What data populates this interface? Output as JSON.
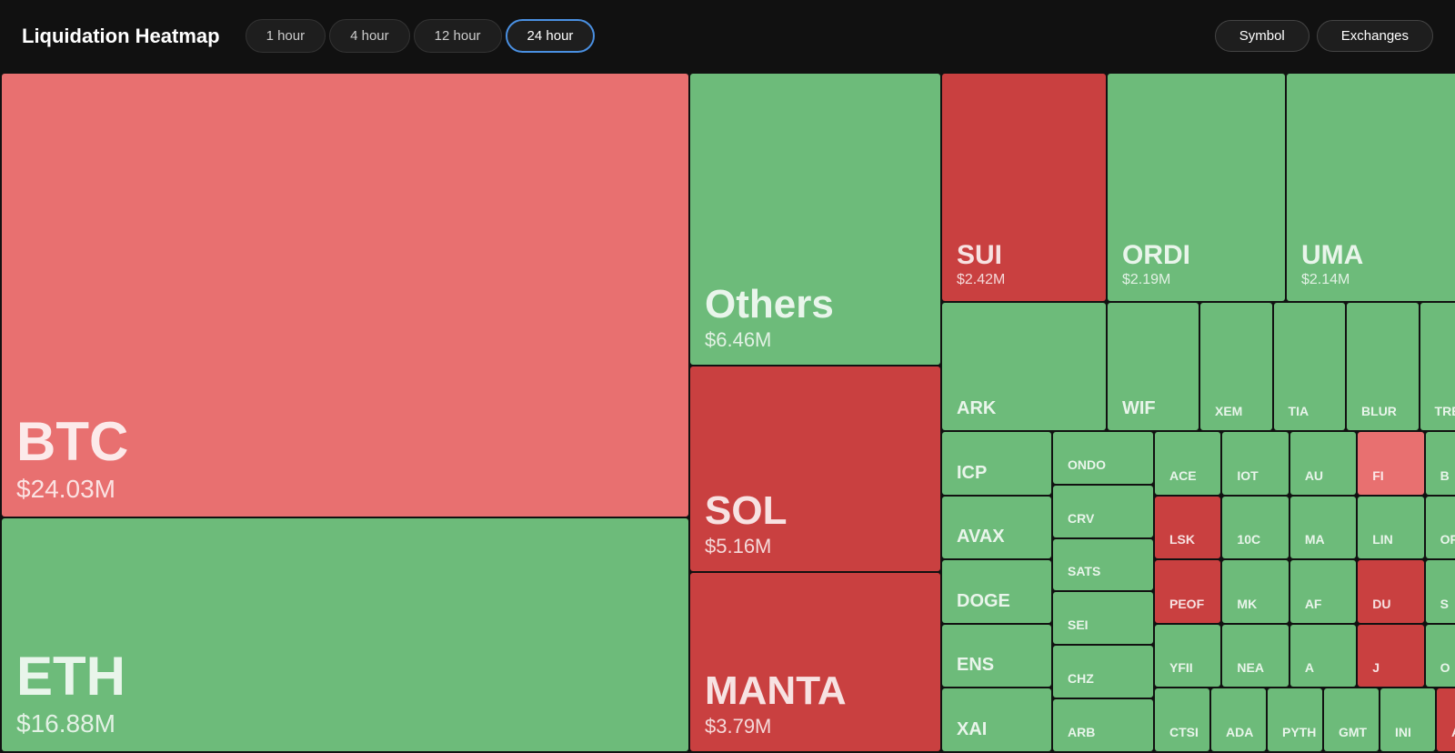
{
  "header": {
    "title": "Liquidation Heatmap",
    "tabs": [
      {
        "label": "1 hour",
        "active": false
      },
      {
        "label": "4 hour",
        "active": false
      },
      {
        "label": "12 hour",
        "active": false
      },
      {
        "label": "24 hour",
        "active": true
      }
    ],
    "right_buttons": [
      "Symbol",
      "Exchanges"
    ]
  },
  "cells": {
    "btc": {
      "name": "BTC",
      "value": "$24.03M",
      "color": "red"
    },
    "eth": {
      "name": "ETH",
      "value": "$16.88M",
      "color": "green"
    },
    "others": {
      "name": "Others",
      "value": "$6.46M",
      "color": "green"
    },
    "sol": {
      "name": "SOL",
      "value": "$5.16M",
      "color": "red"
    },
    "manta": {
      "name": "MANTA",
      "value": "$3.79M",
      "color": "red"
    },
    "sui": {
      "name": "SUI",
      "value": "$2.42M",
      "color": "red"
    },
    "ordi": {
      "name": "ORDI",
      "value": "$2.19M",
      "color": "green"
    },
    "uma": {
      "name": "UMA",
      "value": "$2.14M",
      "color": "green"
    },
    "ark": {
      "name": "ARK",
      "value": "",
      "color": "green"
    },
    "wif": {
      "name": "WIF",
      "value": "",
      "color": "green"
    },
    "xem": {
      "name": "XEM",
      "value": "",
      "color": "green"
    },
    "tia": {
      "name": "TIA",
      "value": "",
      "color": "green"
    },
    "blur": {
      "name": "BLUR",
      "value": "",
      "color": "green"
    },
    "trb": {
      "name": "TRB",
      "value": "",
      "color": "green"
    },
    "icp": {
      "name": "ICP",
      "value": "",
      "color": "green"
    },
    "ondo": {
      "name": "ONDO",
      "value": "",
      "color": "green"
    },
    "ace": {
      "name": "ACE",
      "value": "",
      "color": "green"
    },
    "iot": {
      "name": "IOT",
      "value": "",
      "color": "green"
    },
    "au": {
      "name": "AU",
      "value": "",
      "color": "green"
    },
    "fi": {
      "name": "FI",
      "value": "",
      "color": "red"
    },
    "b": {
      "name": "B",
      "value": "",
      "color": "green"
    },
    "avax": {
      "name": "AVAX",
      "value": "",
      "color": "green"
    },
    "crv": {
      "name": "CRV",
      "value": "",
      "color": "green"
    },
    "lsk": {
      "name": "LSK",
      "value": "",
      "color": "red"
    },
    "toc": {
      "name": "10C",
      "value": "",
      "color": "green"
    },
    "ma": {
      "name": "MA",
      "value": "",
      "color": "green"
    },
    "lin": {
      "name": "LIN",
      "value": "",
      "color": "green"
    },
    "op": {
      "name": "OP",
      "value": "",
      "color": "green"
    },
    "doge": {
      "name": "DOGE",
      "value": "",
      "color": "green"
    },
    "sats": {
      "name": "SATS",
      "value": "",
      "color": "green"
    },
    "peof": {
      "name": "PEOF",
      "value": "",
      "color": "red"
    },
    "mk": {
      "name": "MK",
      "value": "",
      "color": "green"
    },
    "af": {
      "name": "AF",
      "value": "",
      "color": "green"
    },
    "du": {
      "name": "DU",
      "value": "",
      "color": "red"
    },
    "s": {
      "name": "S",
      "value": "",
      "color": "green"
    },
    "ens": {
      "name": "ENS",
      "value": "",
      "color": "green"
    },
    "sei": {
      "name": "SEI",
      "value": "",
      "color": "green"
    },
    "yfii": {
      "name": "YFII",
      "value": "",
      "color": "green"
    },
    "nea": {
      "name": "NEA",
      "value": "",
      "color": "green"
    },
    "a": {
      "name": "A",
      "value": "",
      "color": "green"
    },
    "j": {
      "name": "J",
      "value": "",
      "color": "red"
    },
    "o": {
      "name": "O",
      "value": "",
      "color": "green"
    },
    "xai": {
      "name": "XAI",
      "value": "",
      "color": "green"
    },
    "chz": {
      "name": "CHZ",
      "value": "",
      "color": "green"
    },
    "ctsi": {
      "name": "CTSI",
      "value": "",
      "color": "green"
    },
    "ada": {
      "name": "ADA",
      "value": "",
      "color": "green"
    },
    "arb": {
      "name": "ARB",
      "value": "",
      "color": "green"
    },
    "pyth": {
      "name": "PYTH",
      "value": "",
      "color": "green"
    },
    "gmt": {
      "name": "GMT",
      "value": "",
      "color": "green"
    },
    "ini": {
      "name": "INI",
      "value": "",
      "color": "green"
    },
    "ax": {
      "name": "AX",
      "value": "",
      "color": "red"
    }
  }
}
